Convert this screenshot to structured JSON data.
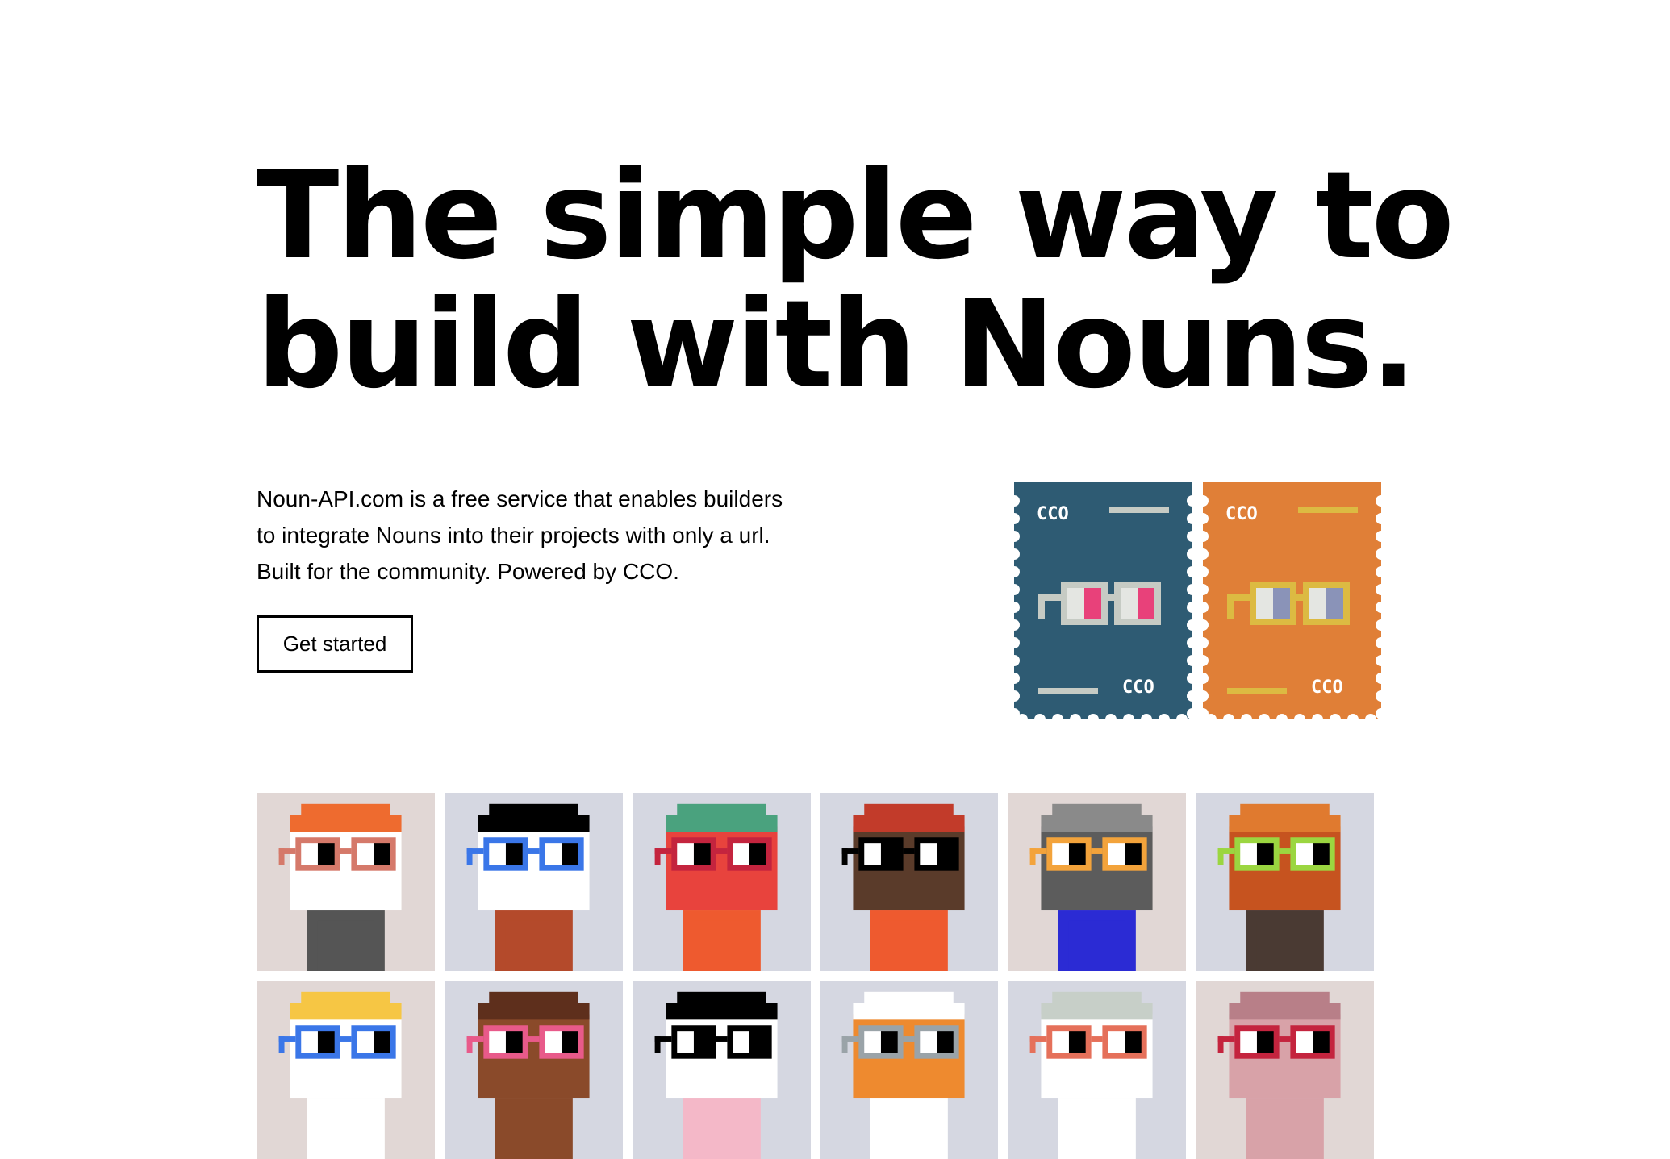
{
  "hero": {
    "line1": "The simple way to",
    "line2": "build with Nouns."
  },
  "intro": {
    "line1": "Noun-API.com is a free service that enables builders",
    "line2": "to integrate Nouns into their projects with only a url.",
    "line3": "Built for the community. Powered by CCO."
  },
  "cta": {
    "label": "Get started"
  },
  "stamps": [
    {
      "bg": "#2e5b73",
      "accent": "#c6cbc4",
      "lens": "#e8417a",
      "text": "CCO"
    },
    {
      "bg": "#e07f37",
      "accent": "#dcba42",
      "lens": "#8a93b8",
      "text": "CCO"
    }
  ],
  "nouns": [
    {
      "name": "noun-orange-hair",
      "bg": "#e1d7d5",
      "head": "#ffffff",
      "head_accent": "#ee6b2f",
      "glasses": "#d5796a",
      "body": "#555555"
    },
    {
      "name": "noun-panda-cap",
      "bg": "#d5d7e1",
      "head": "#ffffff",
      "head_accent": "#000000",
      "glasses": "#3a76e8",
      "body": "#b44a2b"
    },
    {
      "name": "noun-watermelon",
      "bg": "#d5d7e1",
      "head": "#e8433d",
      "head_accent": "#4aa27e",
      "glasses": "#c4243e",
      "body": "#ee5a2f"
    },
    {
      "name": "noun-radio",
      "bg": "#d5d7e1",
      "head": "#5a3b2a",
      "head_accent": "#c23b2a",
      "glasses": "#000000",
      "body": "#ee5a2f"
    },
    {
      "name": "noun-bank",
      "bg": "#e1d7d5",
      "head": "#5c5c5c",
      "head_accent": "#8a8a8a",
      "glasses": "#f3a33b",
      "body": "#2b2bd4"
    },
    {
      "name": "noun-pumpkin",
      "bg": "#d5d7e1",
      "head": "#c6531f",
      "head_accent": "#e07a2f",
      "glasses": "#9bd640",
      "body": "#4a3a33"
    },
    {
      "name": "noun-duck",
      "bg": "#e1d7d5",
      "head": "#ffffff",
      "head_accent": "#f6c644",
      "glasses": "#3a76e8",
      "body": "#ffffff"
    },
    {
      "name": "noun-witch-hat",
      "bg": "#d5d7e1",
      "head": "#8a4a2a",
      "head_accent": "#5e2f1c",
      "glasses": "#e85a8a",
      "body": "#8a4a2a"
    },
    {
      "name": "noun-panda-2",
      "bg": "#d5d7e1",
      "head": "#ffffff",
      "head_accent": "#000000",
      "glasses": "#000000",
      "body": "#f4b8c8"
    },
    {
      "name": "noun-fox",
      "bg": "#d5d7e1",
      "head": "#ee8a2f",
      "head_accent": "#ffffff",
      "glasses": "#9aa3a8",
      "body": "#ffffff"
    },
    {
      "name": "noun-teacup",
      "bg": "#d5d7e1",
      "head": "#ffffff",
      "head_accent": "#c7cfc8",
      "glasses": "#e5705a",
      "body": "#ffffff"
    },
    {
      "name": "noun-brain",
      "bg": "#e1d7d5",
      "head": "#d8a2a8",
      "head_accent": "#b87f88",
      "glasses": "#c4243e",
      "body": "#d8a2a8"
    }
  ]
}
